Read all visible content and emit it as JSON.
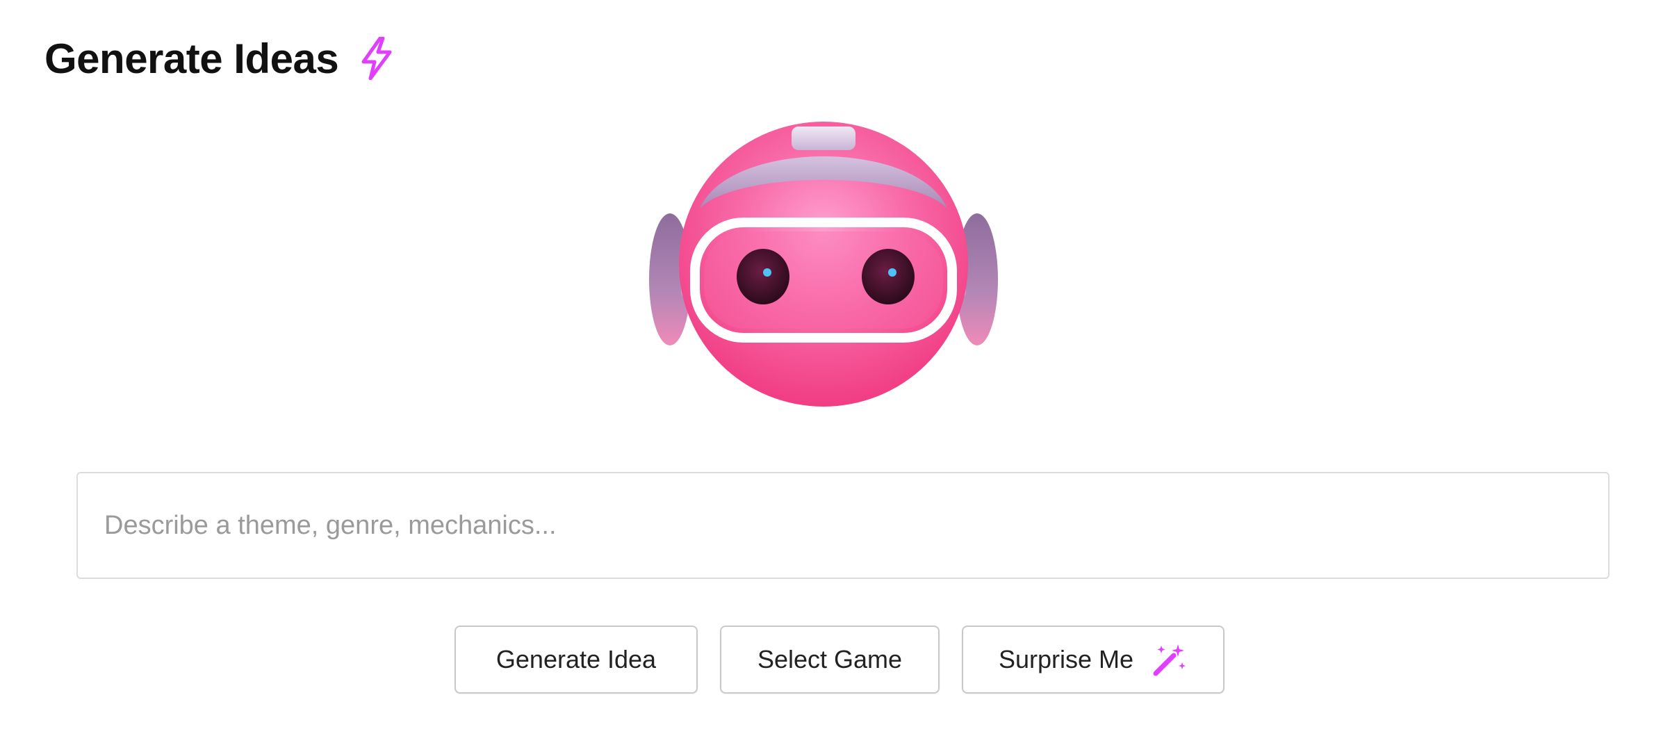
{
  "header": {
    "title": "Generate Ideas",
    "title_icon": "lightning-bolt-icon"
  },
  "mascot": {
    "icon": "robot-mascot-icon",
    "colors": {
      "face": "#f4428a",
      "helmet": "#b79cc4",
      "visor": "#ffffff",
      "eye": "#3a0d24",
      "eye_glint": "#4fc3f7"
    }
  },
  "search": {
    "value": "",
    "placeholder": "Describe a theme, genre, mechanics..."
  },
  "actions": {
    "generate_label": "Generate Idea",
    "select_label": "Select Game",
    "surprise_label": "Surprise Me",
    "surprise_icon": "magic-wand-icon"
  },
  "colors": {
    "accent": "#e040fb",
    "border": "#dcdcdc",
    "text": "#111111",
    "placeholder": "#9a9a9a"
  }
}
